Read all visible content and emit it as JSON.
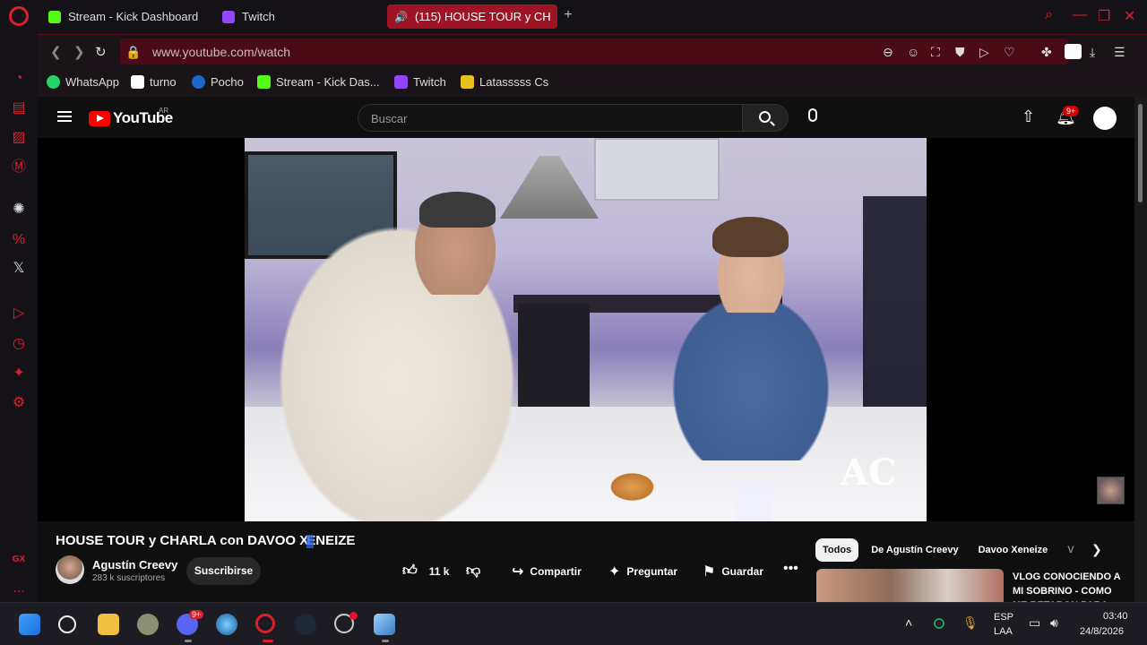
{
  "browser": {
    "tabs": [
      {
        "label": "Stream - Kick Dashboard",
        "color": "#53fc18"
      },
      {
        "label": "Twitch",
        "color": "#9146ff"
      },
      {
        "label": "(115) HOUSE TOUR y CH",
        "color": "#ff0000"
      }
    ],
    "url": "www.youtube.com/watch",
    "bookmarks": [
      {
        "label": "WhatsApp",
        "color": "#25d366"
      },
      {
        "label": "turno",
        "color": "#ffffff"
      },
      {
        "label": "Pocho",
        "color": "#1b6ac9"
      },
      {
        "label": "Stream - Kick Das...",
        "color": "#53fc18"
      },
      {
        "label": "Twitch",
        "color": "#9146ff"
      },
      {
        "label": "Latasssss Cs",
        "color": "#e8c020"
      }
    ],
    "accent": "#d9202f",
    "sidebar_gx": "GX",
    "sidebar_more": "...",
    "sidebar_x": "𝕏",
    "sidebar_percent": "%"
  },
  "youtube": {
    "logo_word": "YouTube",
    "country": "AR",
    "search_placeholder": "Buscar",
    "notifications": "9+",
    "video": {
      "title_a": "HOUSE TOUR y CHARLA con DAVOO X",
      "title_b": "E",
      "title_c": "NEIZE",
      "watermark": "AC"
    },
    "channel": {
      "name": "Agustín Creevy",
      "subs": "283 k suscriptores",
      "subscribe": "Suscribirse"
    },
    "actions": {
      "likes": "11 k",
      "share": "Compartir",
      "ask": "Preguntar",
      "save": "Guardar"
    },
    "chips": [
      "Todos",
      "De Agustín Creevy",
      "Davoo Xeneize",
      "V"
    ],
    "recommended": {
      "title": "VLOG CONOCIENDO A MI SOBRINO - COMO ME RETARON PARA"
    }
  },
  "taskbar": {
    "discord_badge": "9+",
    "lang_a": "ESP",
    "lang_b": "LAA",
    "time": "03:40",
    "date": "24/8/2026"
  }
}
